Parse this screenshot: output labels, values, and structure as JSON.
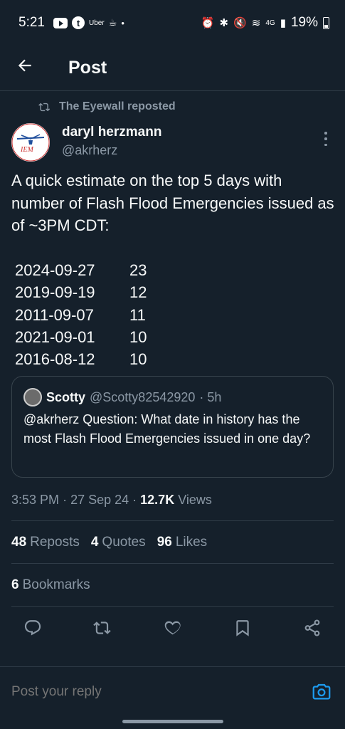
{
  "status_bar": {
    "time": "5:21",
    "uber_label": "Uber",
    "network": "4G",
    "battery": "19%"
  },
  "header": {
    "title": "Post"
  },
  "repost": {
    "text": "The Eyewall reposted"
  },
  "author": {
    "name": "daryl herzmann",
    "handle": "@akrherz",
    "avatar_text": "IEM"
  },
  "tweet": {
    "text": "A quick estimate on the top 5 days with number of Flash Flood Emergencies issued as of ~3PM CDT:",
    "rows": [
      {
        "date": "2024-09-27",
        "count": "23"
      },
      {
        "date": "2019-09-19",
        "count": "12"
      },
      {
        "date": "2011-09-07",
        "count": "11"
      },
      {
        "date": "2021-09-01",
        "count": "10"
      },
      {
        "date": "2016-08-12",
        "count": "10"
      }
    ]
  },
  "quote": {
    "name": "Scotty",
    "handle": "@Scotty82542920",
    "time": "· 5h",
    "text": "@akrherz Question: What date in history has the most Flash Flood Emergencies issued in one day?"
  },
  "meta": {
    "time": "3:53 PM",
    "date": "27 Sep 24",
    "views_count": "12.7K",
    "views_label": "Views"
  },
  "stats": {
    "reposts_count": "48",
    "reposts_label": "Reposts",
    "quotes_count": "4",
    "quotes_label": "Quotes",
    "likes_count": "96",
    "likes_label": "Likes",
    "bookmarks_count": "6",
    "bookmarks_label": "Bookmarks"
  },
  "reply": {
    "placeholder": "Post your reply"
  },
  "colors": {
    "background": "#15202b",
    "muted": "#8b98a5",
    "accent": "#1d9bf0"
  }
}
